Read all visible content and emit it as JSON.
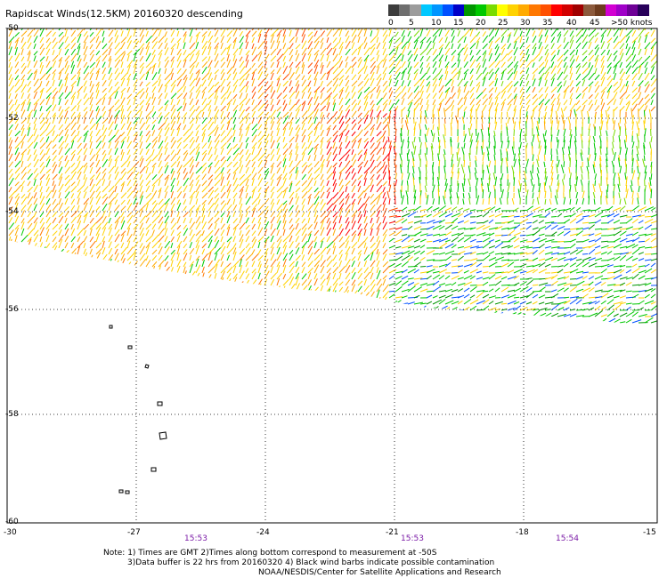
{
  "title": "Rapidscat Winds(12.5KM) 20160320 descending",
  "legend": {
    "colors": [
      "#3c3c3c",
      "#6e6e6e",
      "#9c9c9c",
      "#00c8ff",
      "#0096ff",
      "#0050ff",
      "#0000c8",
      "#009600",
      "#00c800",
      "#78dc00",
      "#ffff00",
      "#ffd200",
      "#ffaa00",
      "#ff7800",
      "#ff5000",
      "#ff0000",
      "#d20000",
      "#a00000",
      "#8c5a3c",
      "#6e3c1e",
      "#d200d2",
      "#a000c8",
      "#6e0096",
      "#28005a"
    ],
    "labels": [
      "0",
      "5",
      "10",
      "15",
      "20",
      "25",
      "30",
      "35",
      "40",
      "45",
      ">50 knots"
    ]
  },
  "lat_labels": [
    "-50",
    "-52",
    "-54",
    "-56",
    "-58",
    "-60"
  ],
  "lon_labels": [
    "-30",
    "-27",
    "-24",
    "-21",
    "-18",
    "-15"
  ],
  "time_labels": [
    "15:53",
    "15:53",
    "15:54"
  ],
  "notes": {
    "line1": "Note: 1) Times are GMT 2)Times along bottom correspond to measurement at -50S",
    "line2": "3)Data buffer is 22 hrs from 20160320 4) Black wind barbs indicate possible contamination",
    "line3": "NOAA/NESDIS/Center for Satellite Applications and Research"
  },
  "islands": [
    "south-sandwich-islands"
  ]
}
